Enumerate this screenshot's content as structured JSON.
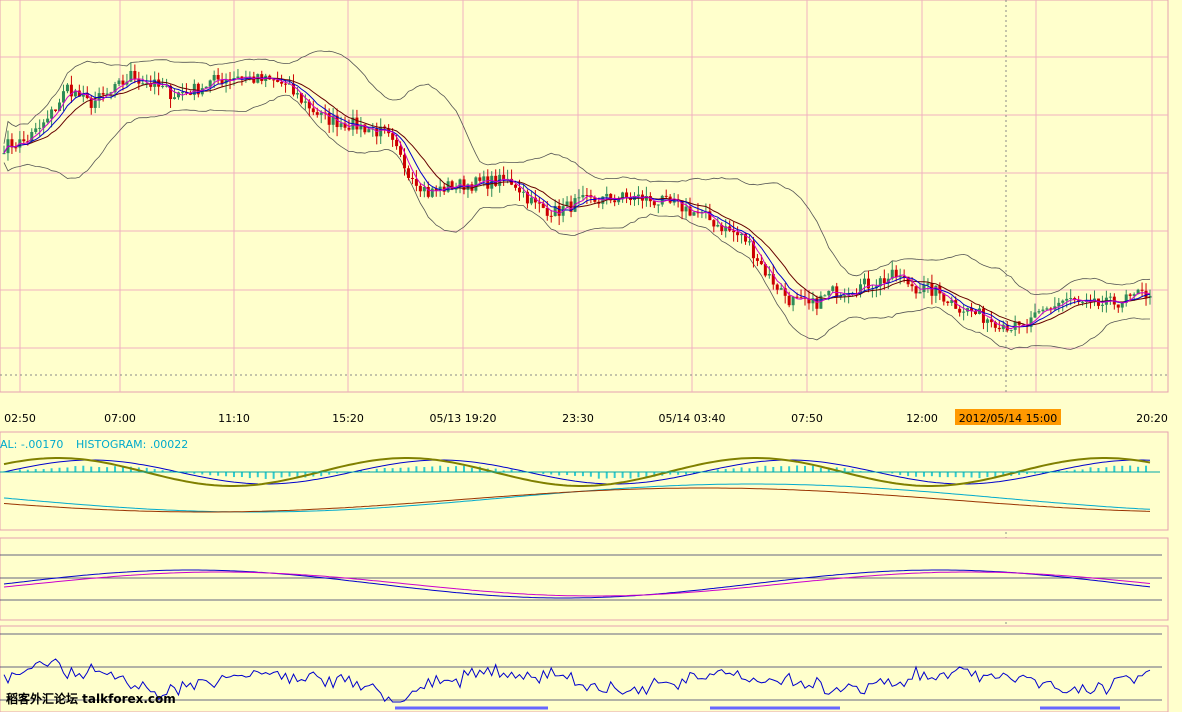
{
  "chart_data": [
    {
      "type": "candlestick",
      "panel": "price",
      "x_ticks": [
        "02:50",
        "07:00",
        "11:10",
        "15:20",
        "05/13 19:20",
        "23:30",
        "05/14 03:40",
        "07:50",
        "12:00",
        "2012/05/14 15:00",
        "20:20"
      ],
      "highlighted_tick": "2012/05/14 15:00",
      "overlays": [
        "bollinger-bands",
        "moving-average-fast",
        "moving-average-slow",
        "moving-average-mid"
      ],
      "trend_closes": [
        50,
        52,
        60,
        75,
        68,
        72,
        80,
        76,
        72,
        74,
        78,
        80,
        78,
        77,
        70,
        62,
        60,
        58,
        55,
        40,
        30,
        33,
        34,
        35,
        35,
        25,
        22,
        26,
        27,
        28,
        28,
        26,
        24,
        20,
        15,
        10,
        -5,
        -15,
        -18,
        -12,
        -10,
        -8,
        -5,
        -10,
        -12,
        -18,
        -22,
        -25,
        -28,
        -20,
        -15,
        -18,
        -17,
        -15,
        -12
      ],
      "grid": true
    },
    {
      "type": "line",
      "panel": "macd",
      "labels": {
        "signal": "AL: -.00170",
        "histogram": "HISTOGRAM: .00022"
      }
    },
    {
      "type": "line",
      "panel": "oscillator-1"
    },
    {
      "type": "line",
      "panel": "oscillator-2"
    }
  ],
  "colors": {
    "background": "#ffffcc",
    "grid": "#f0b0c0",
    "candle_up": "#2e8b57",
    "candle_down": "#cc0000",
    "bollinger": "#555555",
    "ma_fast": "#0000cc",
    "ma_mid": "#cc00cc",
    "ma_slow": "#660000",
    "macd_hist": "#33cccc",
    "macd_olive": "#808000",
    "highlight_tick_bg": "#ff9900"
  },
  "watermark": "稻客外汇论坛 talkforex.com"
}
